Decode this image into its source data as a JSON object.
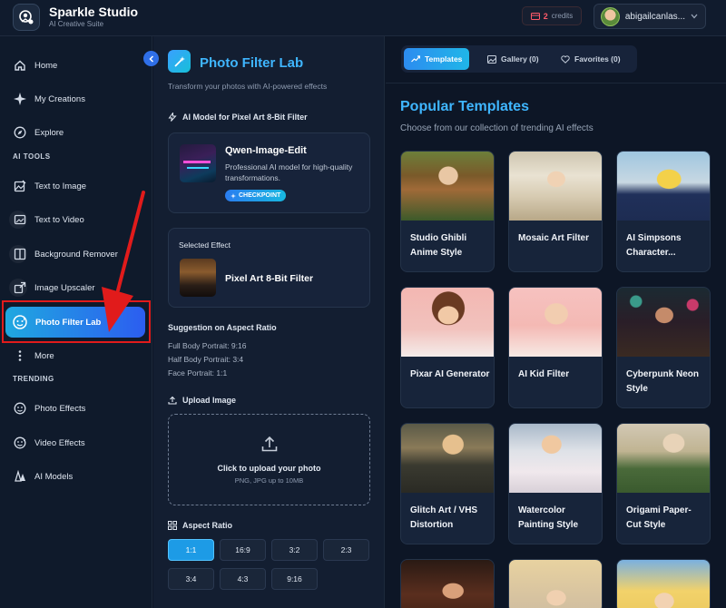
{
  "header": {
    "app_name": "Sparkle Studio",
    "app_subtitle": "AI Creative Suite",
    "credits_count": "2",
    "credits_label": "credits",
    "username": "abigailcanlas..."
  },
  "sidebar": {
    "items_top": [
      {
        "label": "Home",
        "icon": "home-icon"
      },
      {
        "label": "My Creations",
        "icon": "sparkle-icon"
      },
      {
        "label": "Explore",
        "icon": "compass-icon"
      }
    ],
    "ai_tools_title": "AI TOOLS",
    "ai_tools": [
      {
        "label": "Text to Image",
        "icon": "image-edit-icon"
      },
      {
        "label": "Text to Video",
        "icon": "video-icon"
      },
      {
        "label": "Background Remover",
        "icon": "split-icon"
      },
      {
        "label": "Image Upscaler",
        "icon": "upscale-icon"
      },
      {
        "label": "Photo Filter Lab",
        "icon": "face-filter-icon",
        "active": true
      },
      {
        "label": "More",
        "icon": "more-icon"
      }
    ],
    "trending_title": "TRENDING",
    "trending": [
      {
        "label": "Photo Effects",
        "icon": "face-filter-icon"
      },
      {
        "label": "Video Effects",
        "icon": "video-effects-icon"
      },
      {
        "label": "AI Models",
        "icon": "models-icon"
      }
    ]
  },
  "filter_panel": {
    "title": "Photo Filter Lab",
    "subtitle": "Transform your photos with AI-powered effects",
    "model_section_label": "AI Model for Pixel Art 8-Bit Filter",
    "model": {
      "name": "Qwen-Image-Edit",
      "description": "Professional AI model for high-quality transformations.",
      "badge": "CHECKPOINT"
    },
    "selected_effect_label": "Selected Effect",
    "selected_effect_name": "Pixel Art 8-Bit Filter",
    "aspect_suggestion": {
      "title": "Suggestion on Aspect Ratio",
      "lines": [
        "Full Body Portrait: 9:16",
        "Half Body Portrait: 3:4",
        "Face Portrait: 1:1"
      ]
    },
    "upload": {
      "label": "Upload Image",
      "title": "Click to upload your photo",
      "hint": "PNG, JPG up to 10MB"
    },
    "aspect_ratio": {
      "label": "Aspect Ratio",
      "options": [
        "1:1",
        "16:9",
        "3:2",
        "2:3",
        "3:4",
        "4:3",
        "9:16"
      ],
      "selected": "1:1"
    }
  },
  "templates_panel": {
    "tabs": [
      {
        "label": "Templates",
        "active": true
      },
      {
        "label": "Gallery (0)",
        "active": false
      },
      {
        "label": "Favorites (0)",
        "active": false
      }
    ],
    "title": "Popular Templates",
    "subtitle": "Choose from our collection of trending AI effects",
    "templates": [
      {
        "name": "Studio Ghibli Anime Style"
      },
      {
        "name": "Mosaic Art Filter"
      },
      {
        "name": "AI Simpsons Character..."
      },
      {
        "name": "Pixar AI Generator"
      },
      {
        "name": "AI Kid Filter"
      },
      {
        "name": "Cyberpunk Neon Style"
      },
      {
        "name": "Glitch Art / VHS Distortion"
      },
      {
        "name": "Watercolor Painting Style"
      },
      {
        "name": "Origami Paper-Cut Style"
      },
      {
        "name": ""
      },
      {
        "name": ""
      },
      {
        "name": ""
      }
    ]
  },
  "colors": {
    "accent": "#3fb6ff",
    "active_gradient_start": "#1fa8e0",
    "active_gradient_end": "#2c5df0",
    "annotation_red": "#e11b1b"
  }
}
